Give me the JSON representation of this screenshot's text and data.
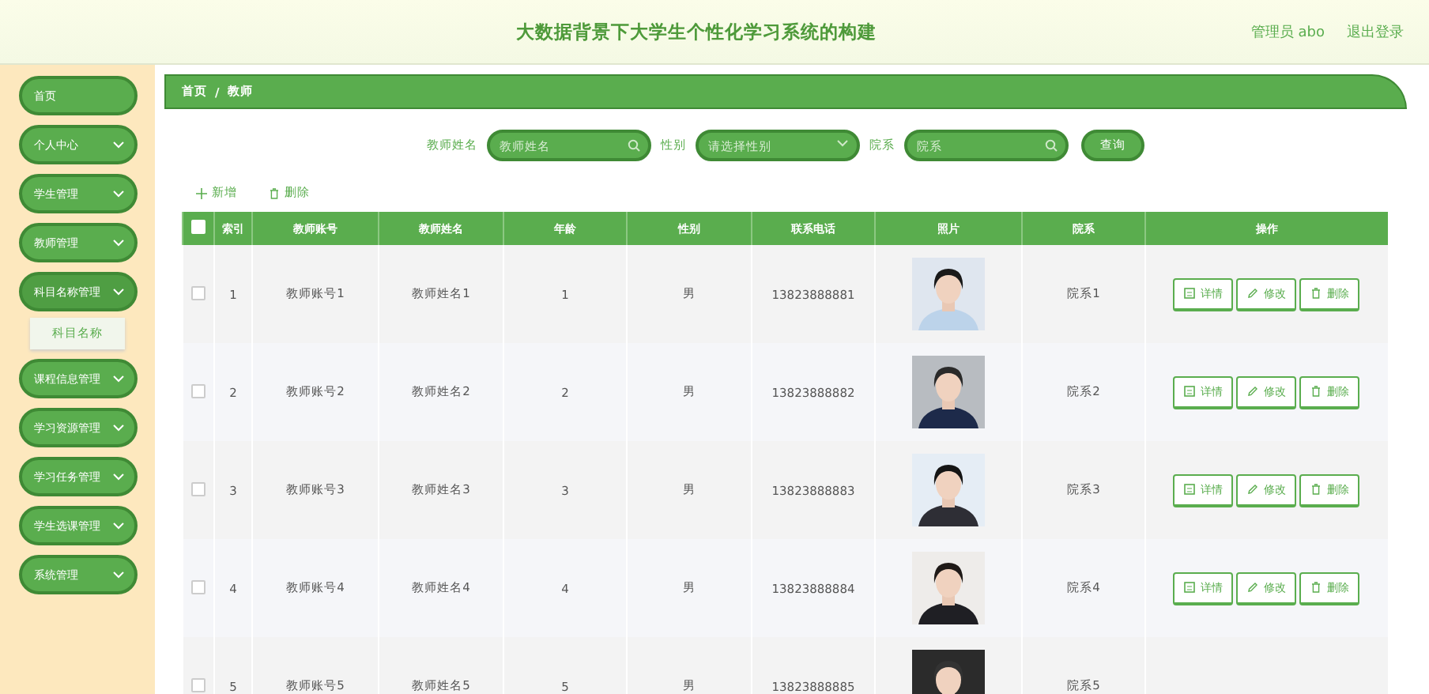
{
  "header": {
    "title": "大数据背景下大学生个性化学习系统的构建",
    "user": "管理员 abo",
    "logout": "退出登录"
  },
  "sidebar": {
    "items": [
      {
        "label": "首页",
        "kind": "link",
        "expanded": false
      },
      {
        "label": "个人中心",
        "kind": "menu",
        "expanded": false
      },
      {
        "label": "学生管理",
        "kind": "menu",
        "expanded": false
      },
      {
        "label": "教师管理",
        "kind": "menu",
        "expanded": false
      },
      {
        "label": "科目名称管理",
        "kind": "menu",
        "expanded": true,
        "children": [
          {
            "label": "科目名称"
          }
        ]
      },
      {
        "label": "课程信息管理",
        "kind": "menu",
        "expanded": false
      },
      {
        "label": "学习资源管理",
        "kind": "menu",
        "expanded": false
      },
      {
        "label": "学习任务管理",
        "kind": "menu",
        "expanded": false
      },
      {
        "label": "学生选课管理",
        "kind": "menu",
        "expanded": false
      },
      {
        "label": "系统管理",
        "kind": "menu",
        "expanded": false
      }
    ]
  },
  "breadcrumb": {
    "items": [
      "首页",
      "教师"
    ],
    "separator": "/"
  },
  "search": {
    "fields": [
      {
        "label": "教师姓名",
        "kind": "text",
        "placeholder": "教师姓名"
      },
      {
        "label": "性别",
        "kind": "select",
        "placeholder": "请选择性别"
      },
      {
        "label": "院系",
        "kind": "text",
        "placeholder": "院系"
      }
    ],
    "button": "查询"
  },
  "toolbar": [
    {
      "label": "新增",
      "kind": "add"
    },
    {
      "label": "删除",
      "kind": "delete"
    }
  ],
  "table": {
    "all_checked": false,
    "columns": [
      "索引",
      "教师账号",
      "教师姓名",
      "年龄",
      "性别",
      "联系电话",
      "照片",
      "院系",
      "操作"
    ],
    "rows": [
      {
        "checked": false,
        "cells": [
          "1",
          "教师账号1",
          "教师姓名1",
          "1",
          "男",
          "13823888881"
        ],
        "photo": {
          "kind": "picture"
        },
        "dept": "院系1",
        "actions": [
          "详情",
          "修改",
          "删除"
        ]
      },
      {
        "checked": false,
        "cells": [
          "2",
          "教师账号2",
          "教师姓名2",
          "2",
          "男",
          "13823888882"
        ],
        "photo": {
          "kind": "picture"
        },
        "dept": "院系2",
        "actions": [
          "详情",
          "修改",
          "删除"
        ]
      },
      {
        "checked": false,
        "cells": [
          "3",
          "教师账号3",
          "教师姓名3",
          "3",
          "男",
          "13823888883"
        ],
        "photo": {
          "kind": "picture"
        },
        "dept": "院系3",
        "actions": [
          "详情",
          "修改",
          "删除"
        ]
      },
      {
        "checked": false,
        "cells": [
          "4",
          "教师账号4",
          "教师姓名4",
          "4",
          "男",
          "13823888884"
        ],
        "photo": {
          "kind": "picture"
        },
        "dept": "院系4",
        "actions": [
          "详情",
          "修改",
          "删除"
        ]
      },
      {
        "checked": false,
        "cells": [
          "5",
          "教师账号5",
          "教师姓名5",
          "5",
          "男",
          "13823888885"
        ],
        "photo": {
          "kind": "picture"
        },
        "dept": "院系5",
        "actions": []
      }
    ]
  }
}
